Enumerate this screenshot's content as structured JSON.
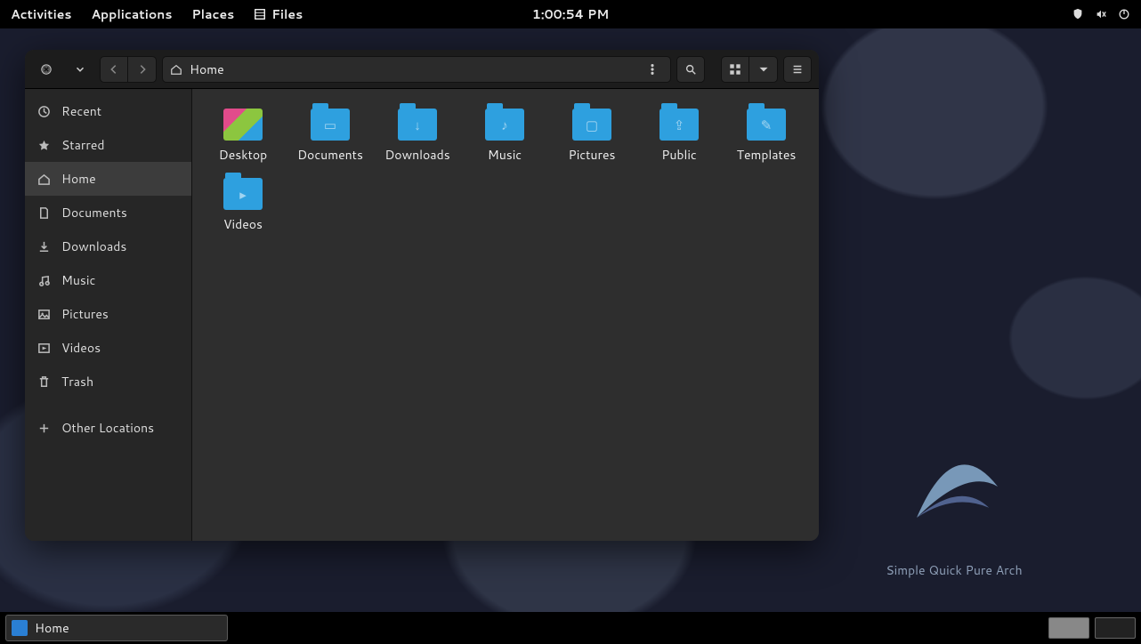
{
  "topbar": {
    "activities": "Activities",
    "applications": "Applications",
    "places": "Places",
    "app_name": "Files",
    "clock": "1:00:54 PM"
  },
  "wallpaper": {
    "tagline": "Simple Quick Pure Arch"
  },
  "fm": {
    "path_label": "Home",
    "sidebar": [
      {
        "icon": "clock",
        "label": "Recent"
      },
      {
        "icon": "star",
        "label": "Starred"
      },
      {
        "icon": "home",
        "label": "Home"
      },
      {
        "icon": "doc",
        "label": "Documents"
      },
      {
        "icon": "download",
        "label": "Downloads"
      },
      {
        "icon": "music",
        "label": "Music"
      },
      {
        "icon": "picture",
        "label": "Pictures"
      },
      {
        "icon": "video",
        "label": "Videos"
      },
      {
        "icon": "trash",
        "label": "Trash"
      },
      {
        "icon": "plus",
        "label": "Other Locations"
      }
    ],
    "files": [
      {
        "label": "Desktop",
        "kind": "desktop",
        "glyph": ""
      },
      {
        "label": "Documents",
        "kind": "folder",
        "glyph": "▭"
      },
      {
        "label": "Downloads",
        "kind": "folder",
        "glyph": "↓"
      },
      {
        "label": "Music",
        "kind": "folder",
        "glyph": "♪"
      },
      {
        "label": "Pictures",
        "kind": "folder",
        "glyph": "▢"
      },
      {
        "label": "Public",
        "kind": "folder",
        "glyph": "⇪"
      },
      {
        "label": "Templates",
        "kind": "folder",
        "glyph": "✎"
      },
      {
        "label": "Videos",
        "kind": "folder",
        "glyph": "▸"
      }
    ]
  },
  "taskbar": {
    "task_label": "Home"
  }
}
